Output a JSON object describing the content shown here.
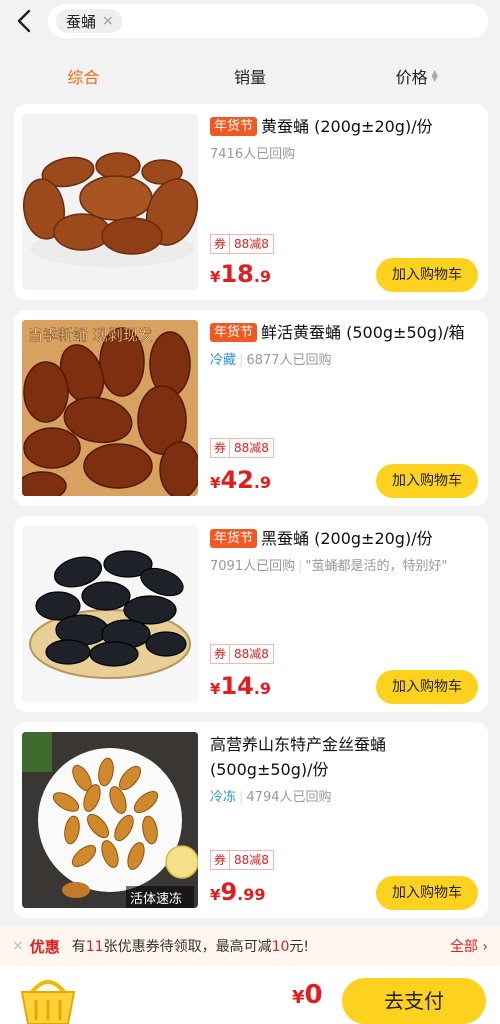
{
  "search": {
    "keyword": "蚕蛹",
    "clear_symbol": "×"
  },
  "sort_tabs": [
    "综合",
    "销量",
    "价格"
  ],
  "products": [
    {
      "festival_tag": "年货节",
      "title": "黄蚕蛹 (200g±20g)/份",
      "storage": "",
      "repurchase": "7416人已回购",
      "review": "",
      "coupon_label": "券",
      "coupon_text": "88减8",
      "price_symbol": "¥",
      "price_int": "18",
      "price_dec": ".9",
      "cart_label": "加入购物车"
    },
    {
      "festival_tag": "年货节",
      "title": "鲜活黄蚕蛹 (500g±50g)/箱",
      "storage": "冷藏",
      "repurchase": "6877人已回购",
      "review": "",
      "image_overlay_text": "当季新蛹 现剥现发",
      "coupon_label": "券",
      "coupon_text": "88减8",
      "price_symbol": "¥",
      "price_int": "42",
      "price_dec": ".9",
      "cart_label": "加入购物车"
    },
    {
      "festival_tag": "年货节",
      "title": "黑蚕蛹 (200g±20g)/份",
      "storage": "",
      "repurchase": "7091人已回购",
      "review": "\"茧蛹都是活的，特别好\"",
      "coupon_label": "券",
      "coupon_text": "88减8",
      "price_symbol": "¥",
      "price_int": "14",
      "price_dec": ".9",
      "cart_label": "加入购物车"
    },
    {
      "festival_tag": "",
      "title": "高营养山东特产金丝蚕蛹 (500g±50g)/份",
      "storage": "冷冻",
      "repurchase": "4794人已回购",
      "review": "",
      "image_overlay_text": "活体速冻",
      "coupon_label": "券",
      "coupon_text": "88减8",
      "price_symbol": "¥",
      "price_int": "9",
      "price_dec": ".99",
      "cart_label": "加入购物车"
    }
  ],
  "promo": {
    "close": "×",
    "label": "优惠",
    "text_prefix": "有",
    "count": "11",
    "text_middle": "张优惠券待领取，最高可减",
    "amount": "10",
    "text_suffix": "元!",
    "all_label": "全部 ›"
  },
  "footer": {
    "total_symbol": "¥",
    "total_value": "0",
    "pay_label": "去支付"
  },
  "colors": {
    "accent_orange": "#f06a1a",
    "price_red": "#e31d1d",
    "button_yellow": "#fdd21f",
    "cold_blue": "#2d8fd8"
  }
}
